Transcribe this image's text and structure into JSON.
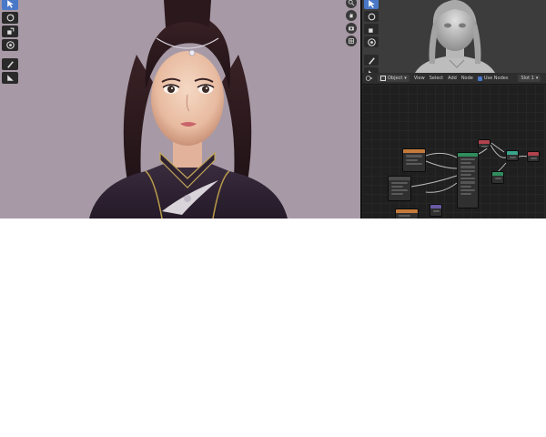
{
  "viewport": {
    "background": "#a79aa6",
    "tools": [
      "cursor-icon",
      "rotate-icon",
      "scale-icon",
      "transform-icon",
      "annotate-icon",
      "measure-icon"
    ],
    "active_tool": "cursor-icon",
    "navigation": [
      "zoom-icon",
      "hand-icon",
      "camera-icon",
      "grid-icon"
    ]
  },
  "side_viewport": {
    "background": "#3c3c3c",
    "tools": [
      "cursor-icon",
      "rotate-icon",
      "scale-icon",
      "transform-icon",
      "annotate-icon",
      "measure-icon"
    ]
  },
  "node_editor": {
    "header": {
      "mode": "Object",
      "menus": [
        "View",
        "Select",
        "Add",
        "Node"
      ],
      "use_nodes_label": "Use Nodes",
      "use_nodes_checked": true,
      "slot": "Slot 1"
    }
  }
}
